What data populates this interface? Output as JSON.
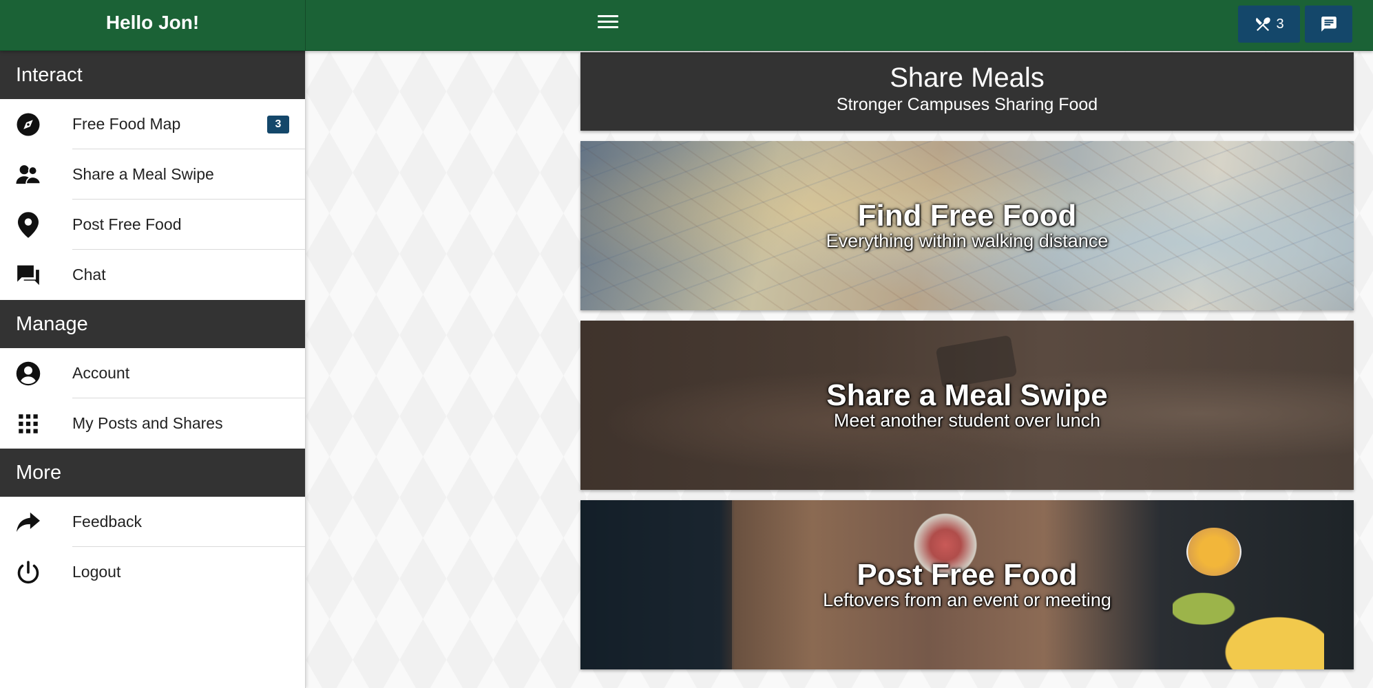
{
  "header": {
    "greeting": "Hello Jon!",
    "food_count": "3"
  },
  "sidebar": {
    "sections": [
      {
        "title": "Interact",
        "items": [
          {
            "label": "Free Food Map",
            "icon": "compass-icon",
            "badge": "3"
          },
          {
            "label": "Share a Meal Swipe",
            "icon": "people-icon"
          },
          {
            "label": "Post Free Food",
            "icon": "map-pin-icon"
          },
          {
            "label": "Chat",
            "icon": "chat-icon"
          }
        ]
      },
      {
        "title": "Manage",
        "items": [
          {
            "label": "Account",
            "icon": "account-icon"
          },
          {
            "label": "My Posts and Shares",
            "icon": "grid-icon"
          }
        ]
      },
      {
        "title": "More",
        "items": [
          {
            "label": "Feedback",
            "icon": "share-arrow-icon"
          },
          {
            "label": "Logout",
            "icon": "power-icon"
          }
        ]
      }
    ]
  },
  "main": {
    "title": "Share Meals",
    "subtitle": "Stronger Campuses Sharing Food",
    "features": [
      {
        "title": "Find Free Food",
        "subtitle": "Everything within walking distance"
      },
      {
        "title": "Share a Meal Swipe",
        "subtitle": "Meet another student over lunch"
      },
      {
        "title": "Post Free Food",
        "subtitle": "Leftovers from an event or meeting"
      }
    ]
  },
  "colors": {
    "topbar": "#1b6236",
    "section_header": "#333333",
    "badge": "#14476a"
  }
}
